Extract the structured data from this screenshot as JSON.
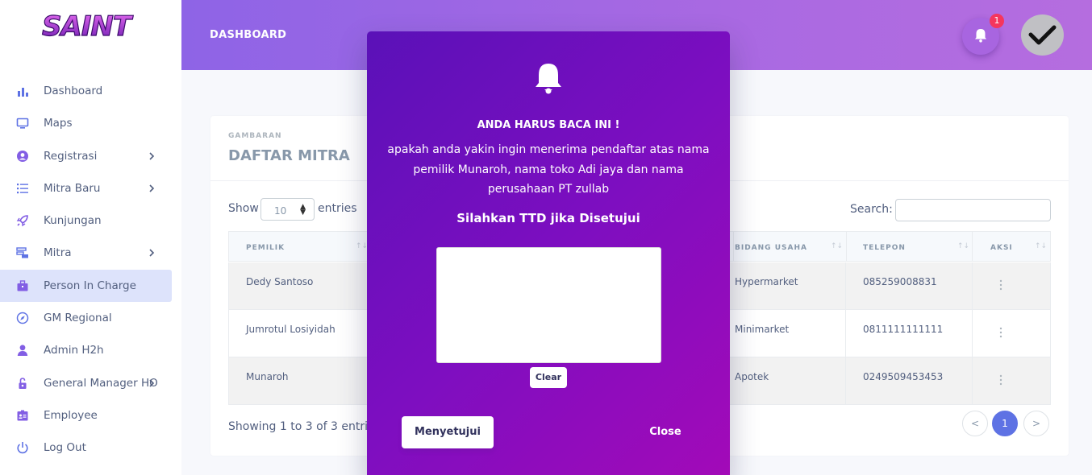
{
  "sidebar": {
    "logo_text": "SAINT",
    "items": [
      {
        "label": "Dashboard",
        "icon": "bar-chart-icon",
        "color": "#5e72e4"
      },
      {
        "label": "Maps",
        "icon": "monitor-icon",
        "color": "#5e72e4"
      },
      {
        "label": "Registrasi",
        "icon": "user-circle-icon",
        "color": "#825ee4"
      },
      {
        "label": "Mitra Baru",
        "icon": "list-icon",
        "color": "#5e72e4"
      },
      {
        "label": "Kunjungan",
        "icon": "rocket-icon",
        "color": "#825ee4"
      },
      {
        "label": "Mitra",
        "icon": "stack-icon",
        "color": "#5e72e4"
      },
      {
        "label": "Person In Charge",
        "icon": "briefcase-icon",
        "color": "#825ee4"
      },
      {
        "label": "GM Regional",
        "icon": "compass-icon",
        "color": "#5e72e4"
      },
      {
        "label": "Admin H2h",
        "icon": "user-icon",
        "color": "#825ee4"
      },
      {
        "label": "General Manager HO",
        "icon": "lock-icon",
        "color": "#825ee4"
      },
      {
        "label": "Employee",
        "icon": "id-card-icon",
        "color": "#825ee4"
      },
      {
        "label": "Log Out",
        "icon": "power-icon",
        "color": "#5e72e4"
      }
    ]
  },
  "header": {
    "title": "DASHBOARD",
    "notification_count": "1"
  },
  "card": {
    "subtitle": "GAMBARAN",
    "title": "DAFTAR MITRA",
    "show_label": "Show",
    "entries_value": "10",
    "entries_label": "entries",
    "search_label": "Search:",
    "columns": [
      "PEMILIK",
      "BIDANG USAHA",
      "TELEPON",
      "AKSI"
    ],
    "rows": [
      {
        "pemilik": "Dedy Santoso",
        "bidang": "Hypermarket",
        "telepon": "085259008831"
      },
      {
        "pemilik": "Jumrotul Losiyidah",
        "bidang": "Minimarket",
        "telepon": "0811111111111"
      },
      {
        "pemilik": "Munaroh",
        "bidang": "Apotek",
        "telepon": "0249509453453"
      }
    ],
    "showing_text": "Showing 1 to 3 of 3 entries",
    "pagination": {
      "prev": "<",
      "current": "1",
      "next": ">"
    }
  },
  "modal": {
    "heading": "ANDA HARUS BACA INI !",
    "message": "apakah anda yakin ingin menerima pendaftar atas nama pemilik Munaroh, nama toko Adi jaya dan nama perusahaan PT zullab",
    "sign_label": "Silahkan TTD jika Disetujui",
    "clear_label": "Clear",
    "approve_label": "Menyetujui",
    "close_label": "Close"
  }
}
